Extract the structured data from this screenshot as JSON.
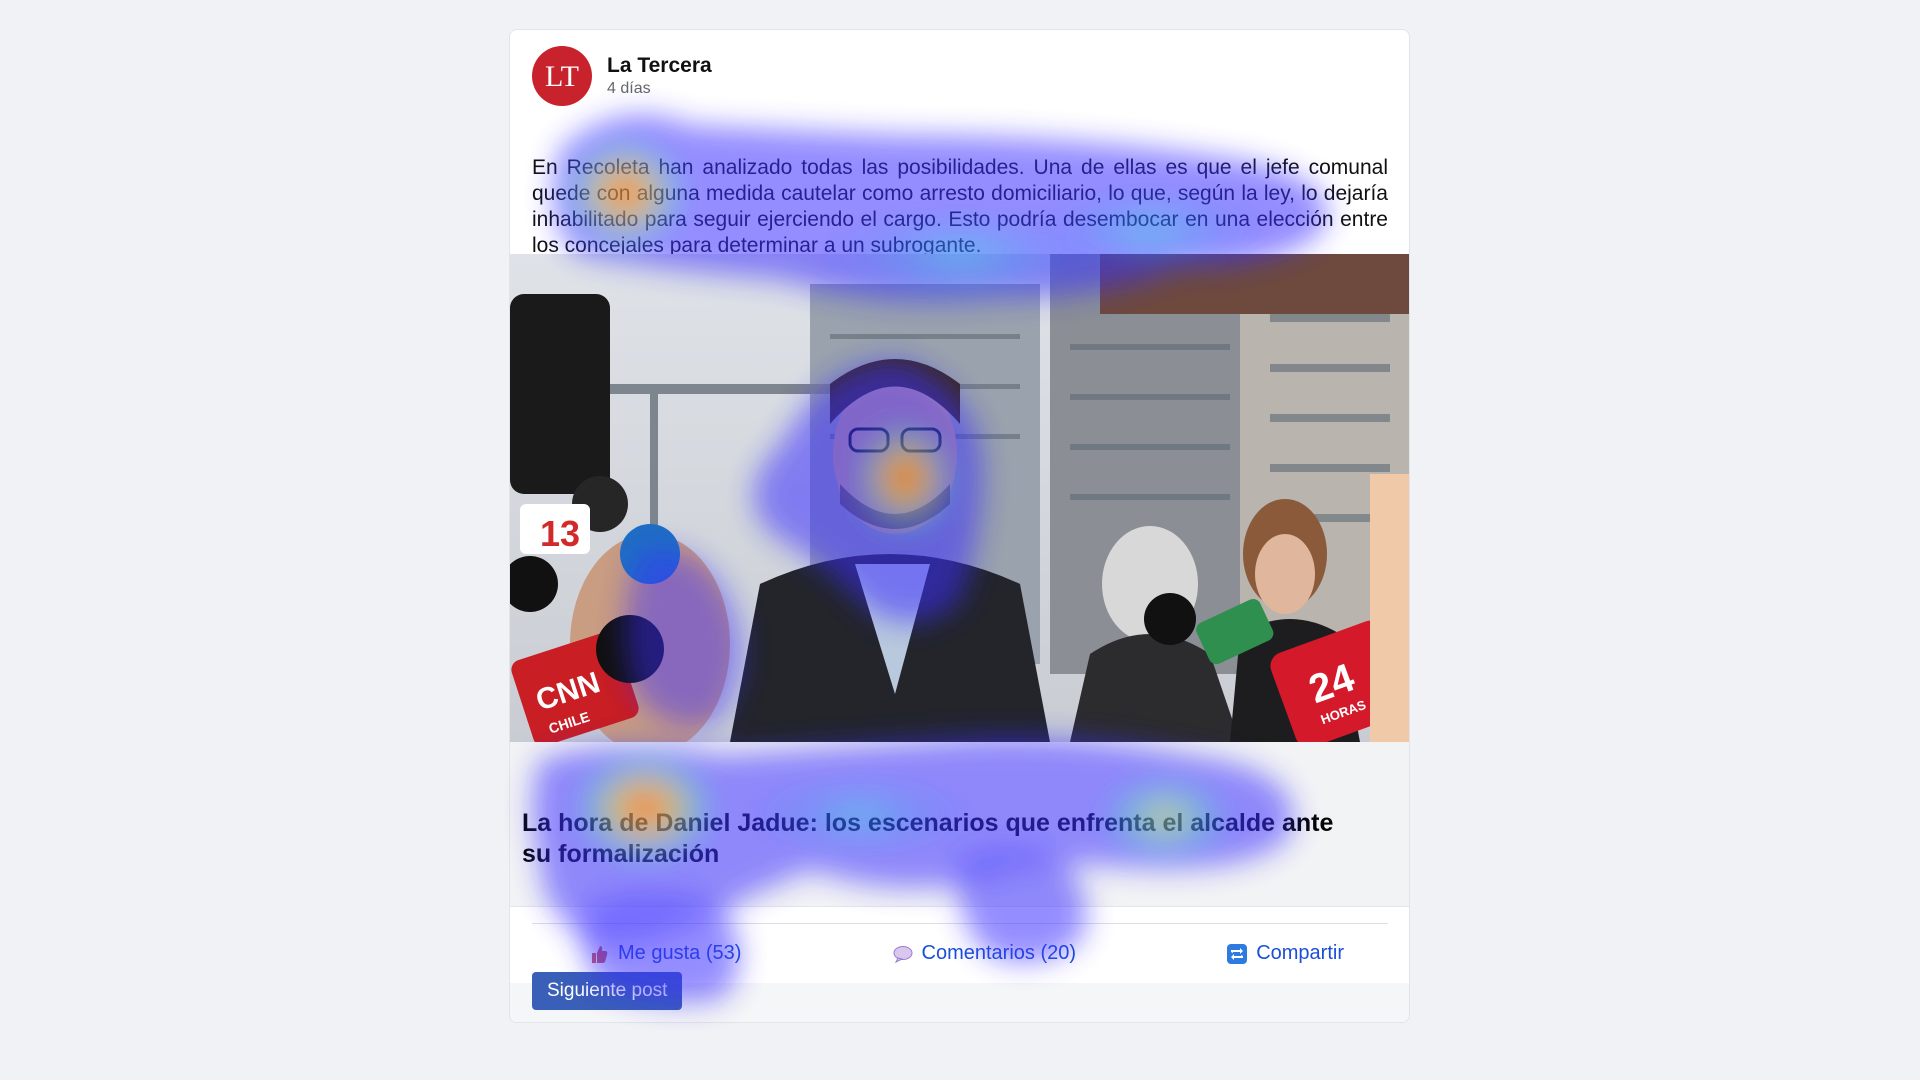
{
  "post": {
    "page_name": "La Tercera",
    "avatar_text": "LT",
    "time": "4 días",
    "body": "En Recoleta han analizado todas las posibilidades. Una de ellas es que el jefe comunal quede con alguna medida cautelar como arresto domiciliario, lo que, según la ley, lo dejaría inhabilitado para seguir ejerciendo el cargo. Esto podría desembocar en una elección entre los concejales para determinar a un subrogante.",
    "link_title": "La hora de Daniel Jadue: los escenarios que enfrenta el alcalde ante su formalización"
  },
  "actions": {
    "like": "Me gusta (53)",
    "comments": "Comentarios (20)",
    "share": "Compartir"
  },
  "next_button": "Siguiente post",
  "image_texts": {
    "mic_left_number": "13",
    "mic_cnn": "CNN",
    "mic_cnn_sub": "CHILE",
    "mic_right_number": "24",
    "mic_right_sub": "HORAS"
  },
  "colors": {
    "brand_red": "#c8232c",
    "link_blue": "#1a4fd8",
    "button_blue": "#3a5fb8",
    "background": "#f0f2f5"
  },
  "icons": {
    "like": "thumbs-up-icon",
    "comments": "speech-bubble-icon",
    "share": "share-repeat-icon"
  }
}
